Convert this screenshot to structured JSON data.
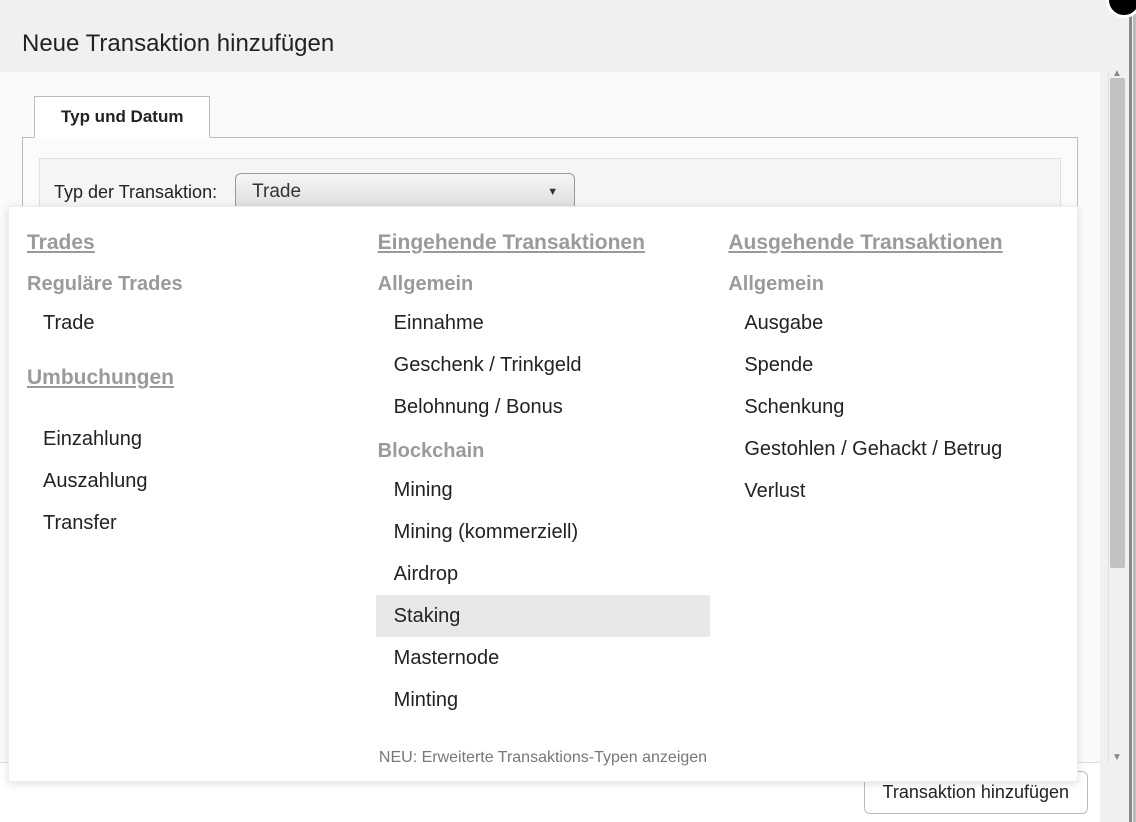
{
  "modal": {
    "title": "Neue Transaktion hinzufügen"
  },
  "tab": {
    "label": "Typ und Datum"
  },
  "form": {
    "type_label": "Typ der Transaktion:",
    "type_value": "Trade"
  },
  "dropdown": {
    "columns": [
      {
        "header": "Trades",
        "groups": [
          {
            "title": "Reguläre Trades",
            "items": [
              "Trade"
            ]
          }
        ],
        "extra_header": "Umbuchungen",
        "extra_items": [
          "Einzahlung",
          "Auszahlung",
          "Transfer"
        ]
      },
      {
        "header": "Eingehende Transaktionen",
        "groups": [
          {
            "title": "Allgemein",
            "items": [
              "Einnahme",
              "Geschenk / Trinkgeld",
              "Belohnung / Bonus"
            ]
          },
          {
            "title": "Blockchain",
            "items": [
              "Mining",
              "Mining (kommerziell)",
              "Airdrop",
              "Staking",
              "Masternode",
              "Minting"
            ]
          }
        ]
      },
      {
        "header": "Ausgehende Transaktionen",
        "groups": [
          {
            "title": "Allgemein",
            "items": [
              "Ausgabe",
              "Spende",
              "Schenkung",
              "Gestohlen / Gehackt / Betrug",
              "Verlust"
            ]
          }
        ]
      }
    ],
    "highlighted": "Staking",
    "footer": "NEU: Erweiterte Transaktions-Typen anzeigen"
  },
  "actions": {
    "submit": "Transaktion hinzufügen"
  }
}
